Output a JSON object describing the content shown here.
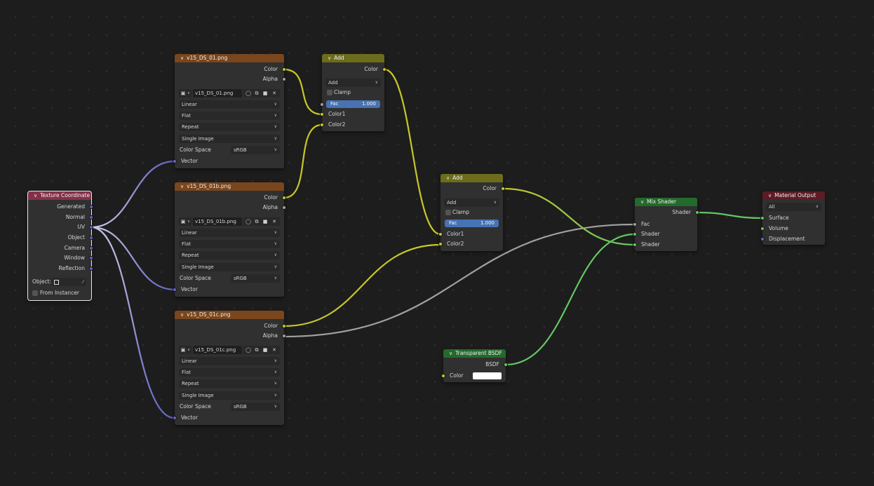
{
  "texture_coordinate": {
    "title": "Texture Coordinate",
    "outputs": [
      "Generated",
      "Normal",
      "UV",
      "Object",
      "Camera",
      "Window",
      "Reflection"
    ],
    "object_label": "Object:",
    "from_instancer": "From Instancer"
  },
  "image_nodes": [
    {
      "title": "v15_DS_01.png",
      "out_color": "Color",
      "out_alpha": "Alpha",
      "image_name": "v15_DS_01.png",
      "interpolation": "Linear",
      "projection": "Flat",
      "extension": "Repeat",
      "source": "Single Image",
      "color_space_label": "Color Space",
      "color_space": "sRGB",
      "in_vector": "Vector"
    },
    {
      "title": "v15_DS_01b.png",
      "out_color": "Color",
      "out_alpha": "Alpha",
      "image_name": "v15_DS_01b.png",
      "interpolation": "Linear",
      "projection": "Flat",
      "extension": "Repeat",
      "source": "Single Image",
      "color_space_label": "Color Space",
      "color_space": "sRGB",
      "in_vector": "Vector"
    },
    {
      "title": "v15_DS_01c.png",
      "out_color": "Color",
      "out_alpha": "Alpha",
      "image_name": "v15_DS_01c.png",
      "interpolation": "Linear",
      "projection": "Flat",
      "extension": "Repeat",
      "source": "Single Image",
      "color_space_label": "Color Space",
      "color_space": "sRGB",
      "in_vector": "Vector"
    }
  ],
  "add_nodes": [
    {
      "title": "Add",
      "out_color": "Color",
      "blend": "Add",
      "clamp": "Clamp",
      "fac_label": "Fac",
      "fac_value": "1.000",
      "in1": "Color1",
      "in2": "Color2",
      "fac_fill": 1.0
    },
    {
      "title": "Add",
      "out_color": "Color",
      "blend": "Add",
      "clamp": "Clamp",
      "fac_label": "Fac",
      "fac_value": "1.000",
      "in1": "Color1",
      "in2": "Color2",
      "fac_fill": 1.0
    }
  ],
  "mix_shader": {
    "title": "Mix Shader",
    "out": "Shader",
    "fac": "Fac",
    "in1": "Shader",
    "in2": "Shader"
  },
  "transparent_bsdf": {
    "title": "Transparent BSDF",
    "out": "BSDF",
    "color_label": "Color",
    "color_value": "#ffffff"
  },
  "material_output": {
    "title": "Material Output",
    "target": "All",
    "inputs": [
      "Surface",
      "Volume",
      "Displacement"
    ]
  },
  "colors": {
    "background": "#1d1d1d",
    "node_body": "#303030",
    "header_input": "#83314a",
    "header_texture": "#79461d",
    "header_color": "#6c6c1c",
    "header_shader": "#246a2c",
    "header_output": "#5c1c25",
    "socket_color": "#c7c729",
    "socket_float": "#a1a1a1",
    "socket_vector": "#6363c7",
    "socket_shader": "#63c763",
    "fac_slider": "#4772b3"
  }
}
